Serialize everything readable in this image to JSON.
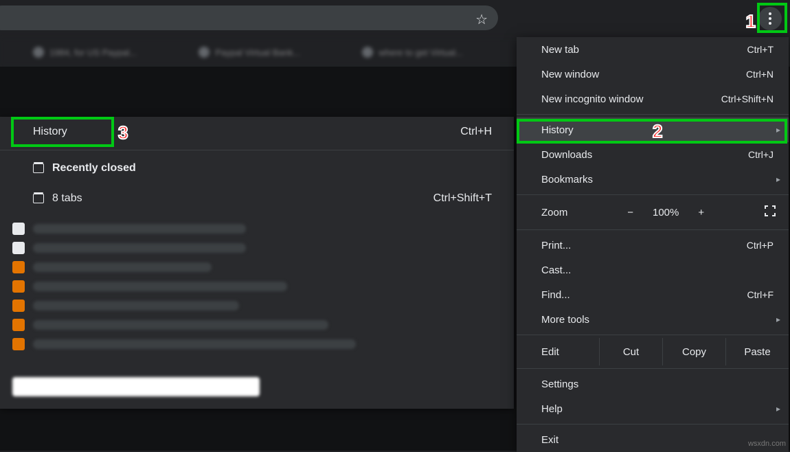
{
  "chrome": {
    "menu_button_title": "Customize and control Google Chrome"
  },
  "bookmarks": [
    "1984, for US Paypal...",
    "Paypal Virtual Bank...",
    "where to get Virtual..."
  ],
  "submenu": {
    "history_label": "History",
    "history_shortcut": "Ctrl+H",
    "recently_closed": "Recently closed",
    "tabs_label": "8 tabs",
    "tabs_shortcut": "Ctrl+Shift+T"
  },
  "menu": {
    "new_tab": {
      "label": "New tab",
      "shortcut": "Ctrl+T"
    },
    "new_window": {
      "label": "New window",
      "shortcut": "Ctrl+N"
    },
    "incognito": {
      "label": "New incognito window",
      "shortcut": "Ctrl+Shift+N"
    },
    "history": {
      "label": "History"
    },
    "downloads": {
      "label": "Downloads",
      "shortcut": "Ctrl+J"
    },
    "bookmarks": {
      "label": "Bookmarks"
    },
    "zoom_label": "Zoom",
    "zoom_minus": "−",
    "zoom_value": "100%",
    "zoom_plus": "+",
    "print": {
      "label": "Print...",
      "shortcut": "Ctrl+P"
    },
    "cast": {
      "label": "Cast..."
    },
    "find": {
      "label": "Find...",
      "shortcut": "Ctrl+F"
    },
    "more_tools": {
      "label": "More tools"
    },
    "edit_label": "Edit",
    "cut": "Cut",
    "copy": "Copy",
    "paste": "Paste",
    "settings": {
      "label": "Settings"
    },
    "help": {
      "label": "Help"
    },
    "exit": {
      "label": "Exit"
    }
  },
  "annotations": {
    "b1": "1",
    "b2": "2",
    "b3": "3"
  },
  "watermark": "wsxdn.com"
}
